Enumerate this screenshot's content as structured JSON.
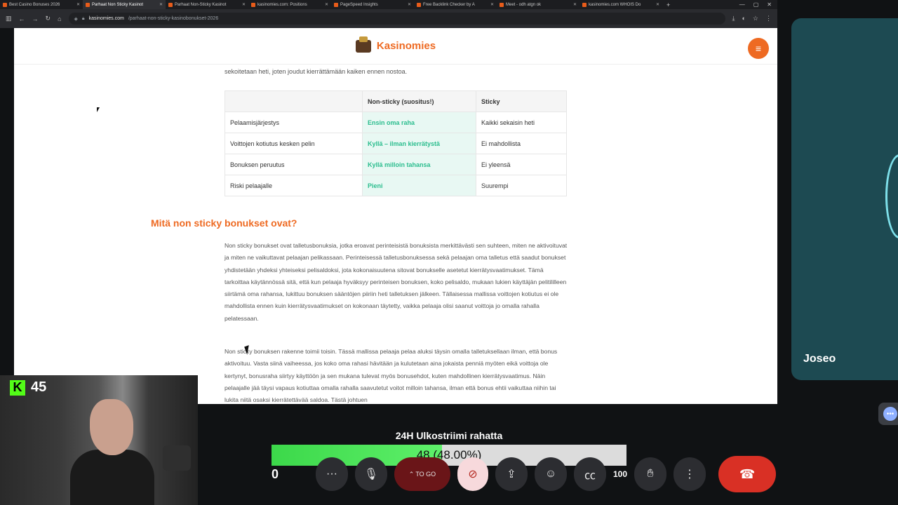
{
  "browser": {
    "tabs": [
      {
        "label": "Best Casino Bonuses 2026"
      },
      {
        "label": "Parhaat Non Sticky Kasinot",
        "active": true
      },
      {
        "label": "Parhaat Non-Sticky Kasinot"
      },
      {
        "label": "kasinomies.com: Positions"
      },
      {
        "label": "PageSpeed Insights"
      },
      {
        "label": "Free Backlink Checker by A"
      },
      {
        "label": "Meet - odh atgn ok"
      },
      {
        "label": "kasinomies.com WHOIS Do"
      }
    ],
    "new_tab": "+",
    "url_host": "kasinomies.com",
    "url_path": "/parhaat-non-sticky-kasinobonukset-2026"
  },
  "site": {
    "brand": "Kasinomies",
    "menu_icon": "≡",
    "intro_text": "sekoitetaan heti, joten joudut kierrättämään kaiken ennen nostoa.",
    "table": {
      "headers": [
        "",
        "Non-sticky (suositus!)",
        "Sticky"
      ],
      "rows": [
        [
          "Pelaamisjärjestys",
          "Ensin oma raha",
          "Kaikki sekaisin heti"
        ],
        [
          "Voittojen kotiutus kesken pelin",
          "Kyllä – ilman kierrätystä",
          "Ei mahdollista"
        ],
        [
          "Bonuksen peruutus",
          "Kyllä milloin tahansa",
          "Ei yleensä"
        ],
        [
          "Riski pelaajalle",
          "Pieni",
          "Suurempi"
        ]
      ]
    },
    "heading": "Mitä non sticky bonukset ovat?",
    "paragraph1": "Non sticky bonukset ovat talletusbonuksia, jotka eroavat perinteisistä bonuksista merkittävästi sen suhteen, miten ne aktivoituvat ja miten ne vaikuttavat pelaajan pelikassaan. Perinteisessä talletusbonuksessa sekä pelaajan oma talletus että saadut bonukset yhdistetään yhdeksi yhteiseksi pelisaldoksi, jota kokonaisuutena sitovat bonukselle asetetut kierrätysvaatimukset. Tämä tarkoittaa käytännössä sitä, että kun pelaaja hyväksyy perinteisen bonuksen, koko pelisaldo, mukaan lukien käyttäjän pelitililleen siirtämä oma rahansa, lukittuu bonuksen sääntöjen piiriin heti talletuksen jälkeen. Tällaisessa mallissa voittojen kotiutus ei ole mahdollista ennen kuin kierrätysvaatimukset on kokonaan täytetty, vaikka pelaaja olisi saanut voittoja jo omalla rahalla pelatessaan.",
    "paragraph2": "Non sticky bonuksen rakenne toimii toisin. Tässä mallissa pelaaja pelaa aluksi täysin omalla talletuksellaan ilman, että bonus aktivoituu. Vasta siinä vaiheessa, jos koko oma rahasi hävitään ja kulutetaan aina jokaista penniä myöten eikä voittoja ole kertynyt, bonusraha siirtyy käyttöön ja sen mukana tulevat myös bonusehdot, kuten mahdollinen kierrätysvaatimus. Näin pelaajalle jää täysi vapaus kotiuttaa omalla rahalla saavutetut voitot milloin tahansa, ilman että bonus ehtii vaikuttaa niihin tai lukita niitä osaksi kierrätettävää saldoa. Tästä johtuen"
  },
  "meet": {
    "participant_name": "Joseo",
    "viewer_count": "100",
    "present_label": "TO GO",
    "hand_count": ""
  },
  "stream": {
    "kick_viewers": "45",
    "goal_title": "24H Ulkostriimi rahatta",
    "goal_value": "48 (48.00%)",
    "goal_start": "0",
    "goal_progress": 0.48
  },
  "colors": {
    "brand_orange": "#ee6a22",
    "highlight_green": "#2bbd8e",
    "goal_green": "#3cd84a",
    "hangup_red": "#d93025",
    "kick_green": "#53fc18"
  }
}
